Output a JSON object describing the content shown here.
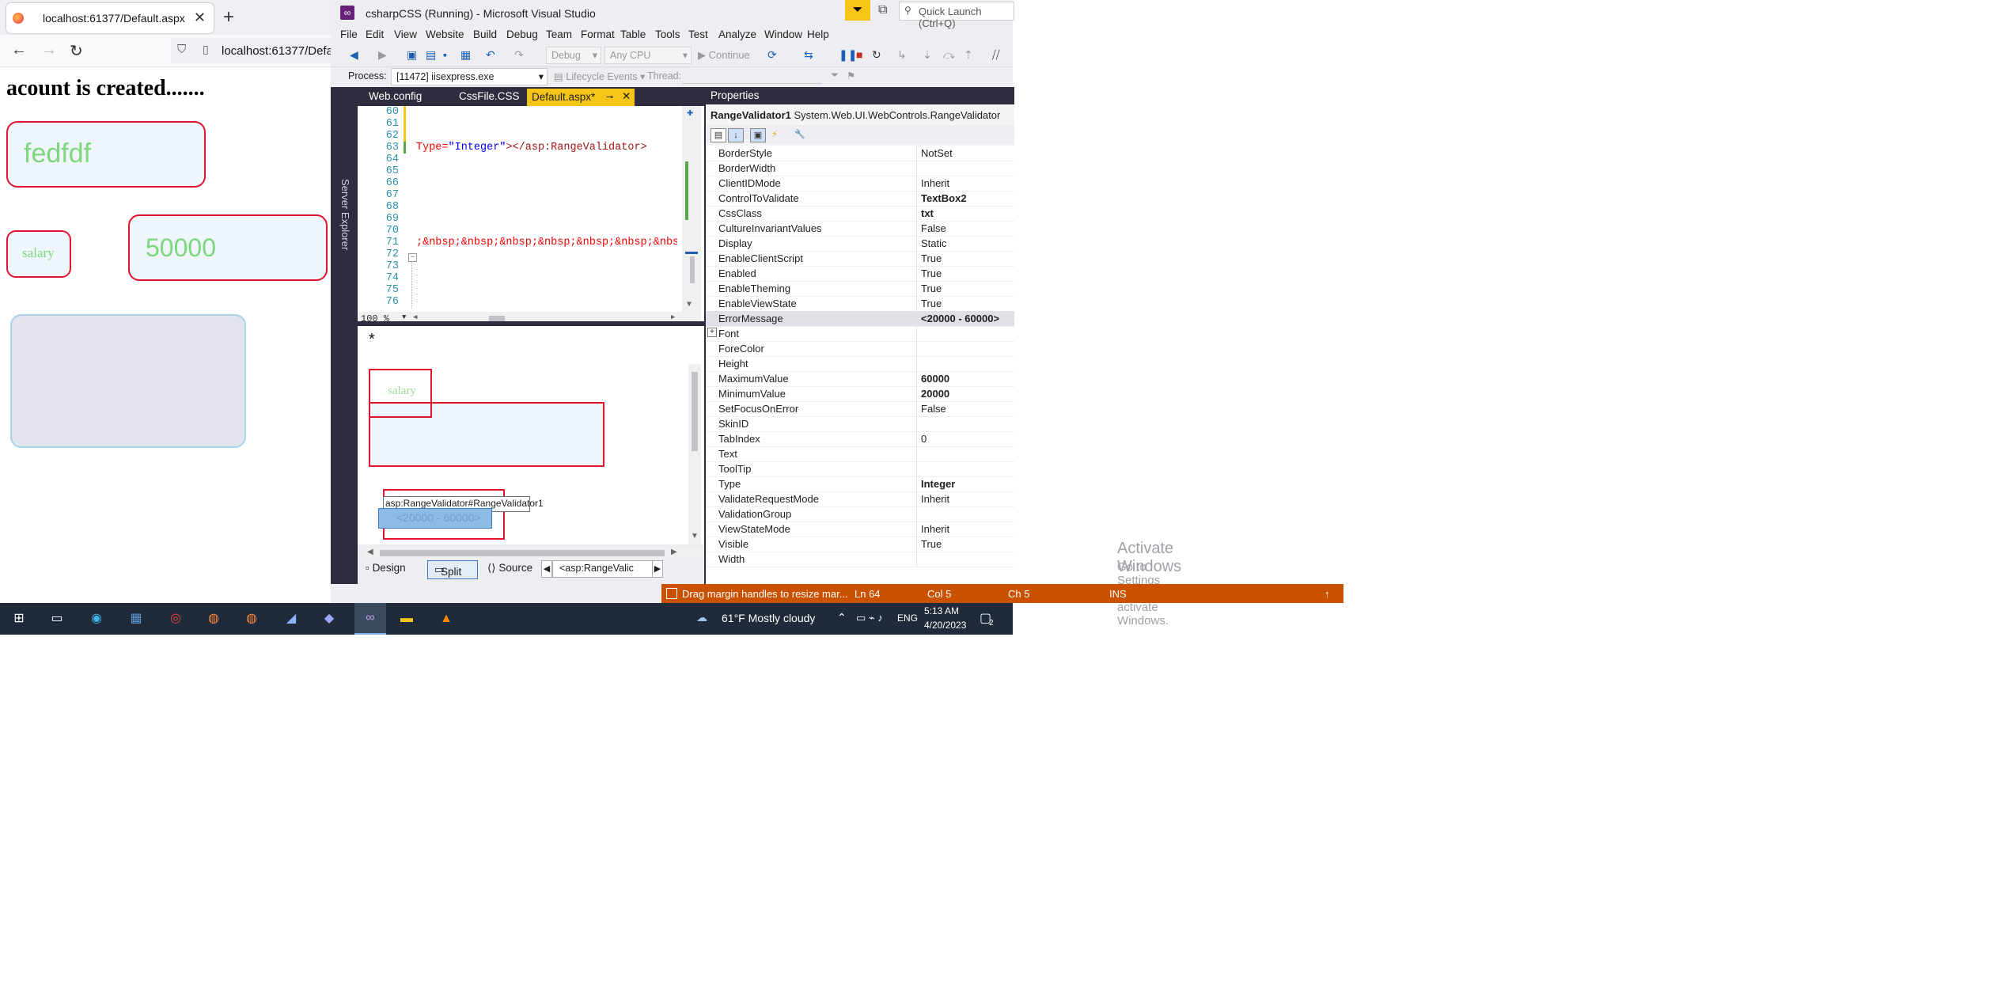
{
  "browser": {
    "tab_title": "localhost:61377/Default.aspx",
    "new_tab": "+",
    "url": "localhost:61377/Defa",
    "page": {
      "heading": "acount is created.......",
      "name_value": "fedfdf",
      "salary_label": "salary",
      "salary_value": "50000"
    }
  },
  "vs": {
    "title": "csharpCSS (Running) - Microsoft Visual Studio",
    "quick_launch": "Quick Launch (Ctrl+Q)",
    "menu": [
      "File",
      "Edit",
      "View",
      "Website",
      "Build",
      "Debug",
      "Team",
      "Format",
      "Table",
      "Tools",
      "Test",
      "Analyze",
      "Window",
      "Help"
    ],
    "toolbar": {
      "config": "Debug",
      "platform": "Any CPU",
      "continue": "Continue"
    },
    "debug_bar": {
      "process_label": "Process:",
      "process_value": "[11472] iisexpress.exe",
      "lifecycle": "Lifecycle Events",
      "thread_label": "Thread:"
    },
    "server_explorer": "Server Explorer",
    "doc_tabs": [
      "Web.config",
      "CssFile.CSS",
      "Default.aspx*"
    ],
    "editor": {
      "line_numbers": [
        "60",
        "61",
        "62",
        "63",
        "64",
        "65",
        "66",
        "67",
        "68",
        "69",
        "70",
        "71",
        "72",
        "73",
        "74",
        "75",
        "76"
      ],
      "line63_attr": "Type=",
      "line63_val": "\"Integer\"",
      "line63_tag": "></asp:RangeValidator>",
      "line71": ";&nbsp;&nbsp;&nbsp;&nbsp;&nbsp;&nbsp;&nbsp;",
      "zoom": "100 %"
    },
    "design": {
      "asterisk": "*",
      "salary_label": "salary",
      "tag_label": "asp:RangeValidator#RangeValidator1",
      "validator_text": "<20000 - 60000>"
    },
    "view_tabs": {
      "design": "Design",
      "split": "Split",
      "source": "Source",
      "breadcrumb": "<asp:RangeValic"
    },
    "properties": {
      "title": "Properties",
      "object_name": "RangeValidator1",
      "object_type": "System.Web.UI.WebControls.RangeValidator",
      "rows": [
        {
          "name": "BorderStyle",
          "value": "NotSet",
          "bold": false
        },
        {
          "name": "BorderWidth",
          "value": "",
          "bold": false
        },
        {
          "name": "ClientIDMode",
          "value": "Inherit",
          "bold": false
        },
        {
          "name": "ControlToValidate",
          "value": "TextBox2",
          "bold": true
        },
        {
          "name": "CssClass",
          "value": "txt",
          "bold": true
        },
        {
          "name": "CultureInvariantValues",
          "value": "False",
          "bold": false
        },
        {
          "name": "Display",
          "value": "Static",
          "bold": false
        },
        {
          "name": "EnableClientScript",
          "value": "True",
          "bold": false
        },
        {
          "name": "Enabled",
          "value": "True",
          "bold": false
        },
        {
          "name": "EnableTheming",
          "value": "True",
          "bold": false
        },
        {
          "name": "EnableViewState",
          "value": "True",
          "bold": false
        },
        {
          "name": "ErrorMessage",
          "value": "<20000 - 60000>",
          "bold": true
        },
        {
          "name": "Font",
          "value": "",
          "bold": false
        },
        {
          "name": "ForeColor",
          "value": "",
          "bold": false
        },
        {
          "name": "Height",
          "value": "",
          "bold": false
        },
        {
          "name": "MaximumValue",
          "value": "60000",
          "bold": true
        },
        {
          "name": "MinimumValue",
          "value": "20000",
          "bold": true
        },
        {
          "name": "SetFocusOnError",
          "value": "False",
          "bold": false
        },
        {
          "name": "SkinID",
          "value": "",
          "bold": false
        },
        {
          "name": "TabIndex",
          "value": "0",
          "bold": false
        },
        {
          "name": "Text",
          "value": "",
          "bold": false
        },
        {
          "name": "ToolTip",
          "value": "",
          "bold": false
        },
        {
          "name": "Type",
          "value": "Integer",
          "bold": true
        },
        {
          "name": "ValidateRequestMode",
          "value": "Inherit",
          "bold": false
        },
        {
          "name": "ValidationGroup",
          "value": "",
          "bold": false
        },
        {
          "name": "ViewStateMode",
          "value": "Inherit",
          "bold": false
        },
        {
          "name": "Visible",
          "value": "True",
          "bold": false
        },
        {
          "name": "Width",
          "value": "",
          "bold": false
        }
      ]
    },
    "watermark_title": "Activate Windows",
    "watermark_sub": "Go to Settings to activate Windows.",
    "status": {
      "message": "Drag margin handles to resize mar...",
      "ln": "Ln 64",
      "col": "Col 5",
      "ch": "Ch 5",
      "mode": "INS"
    }
  },
  "taskbar": {
    "weather": "61°F  Mostly cloudy",
    "lang": "ENG",
    "time": "5:13 AM",
    "date": "4/20/2023",
    "notif_count": "2"
  },
  "colors": {
    "vs_accent": "#f5c518",
    "status_bar": "#ca5100",
    "validator_border": "#e0142c",
    "input_text": "#7ed67e"
  }
}
